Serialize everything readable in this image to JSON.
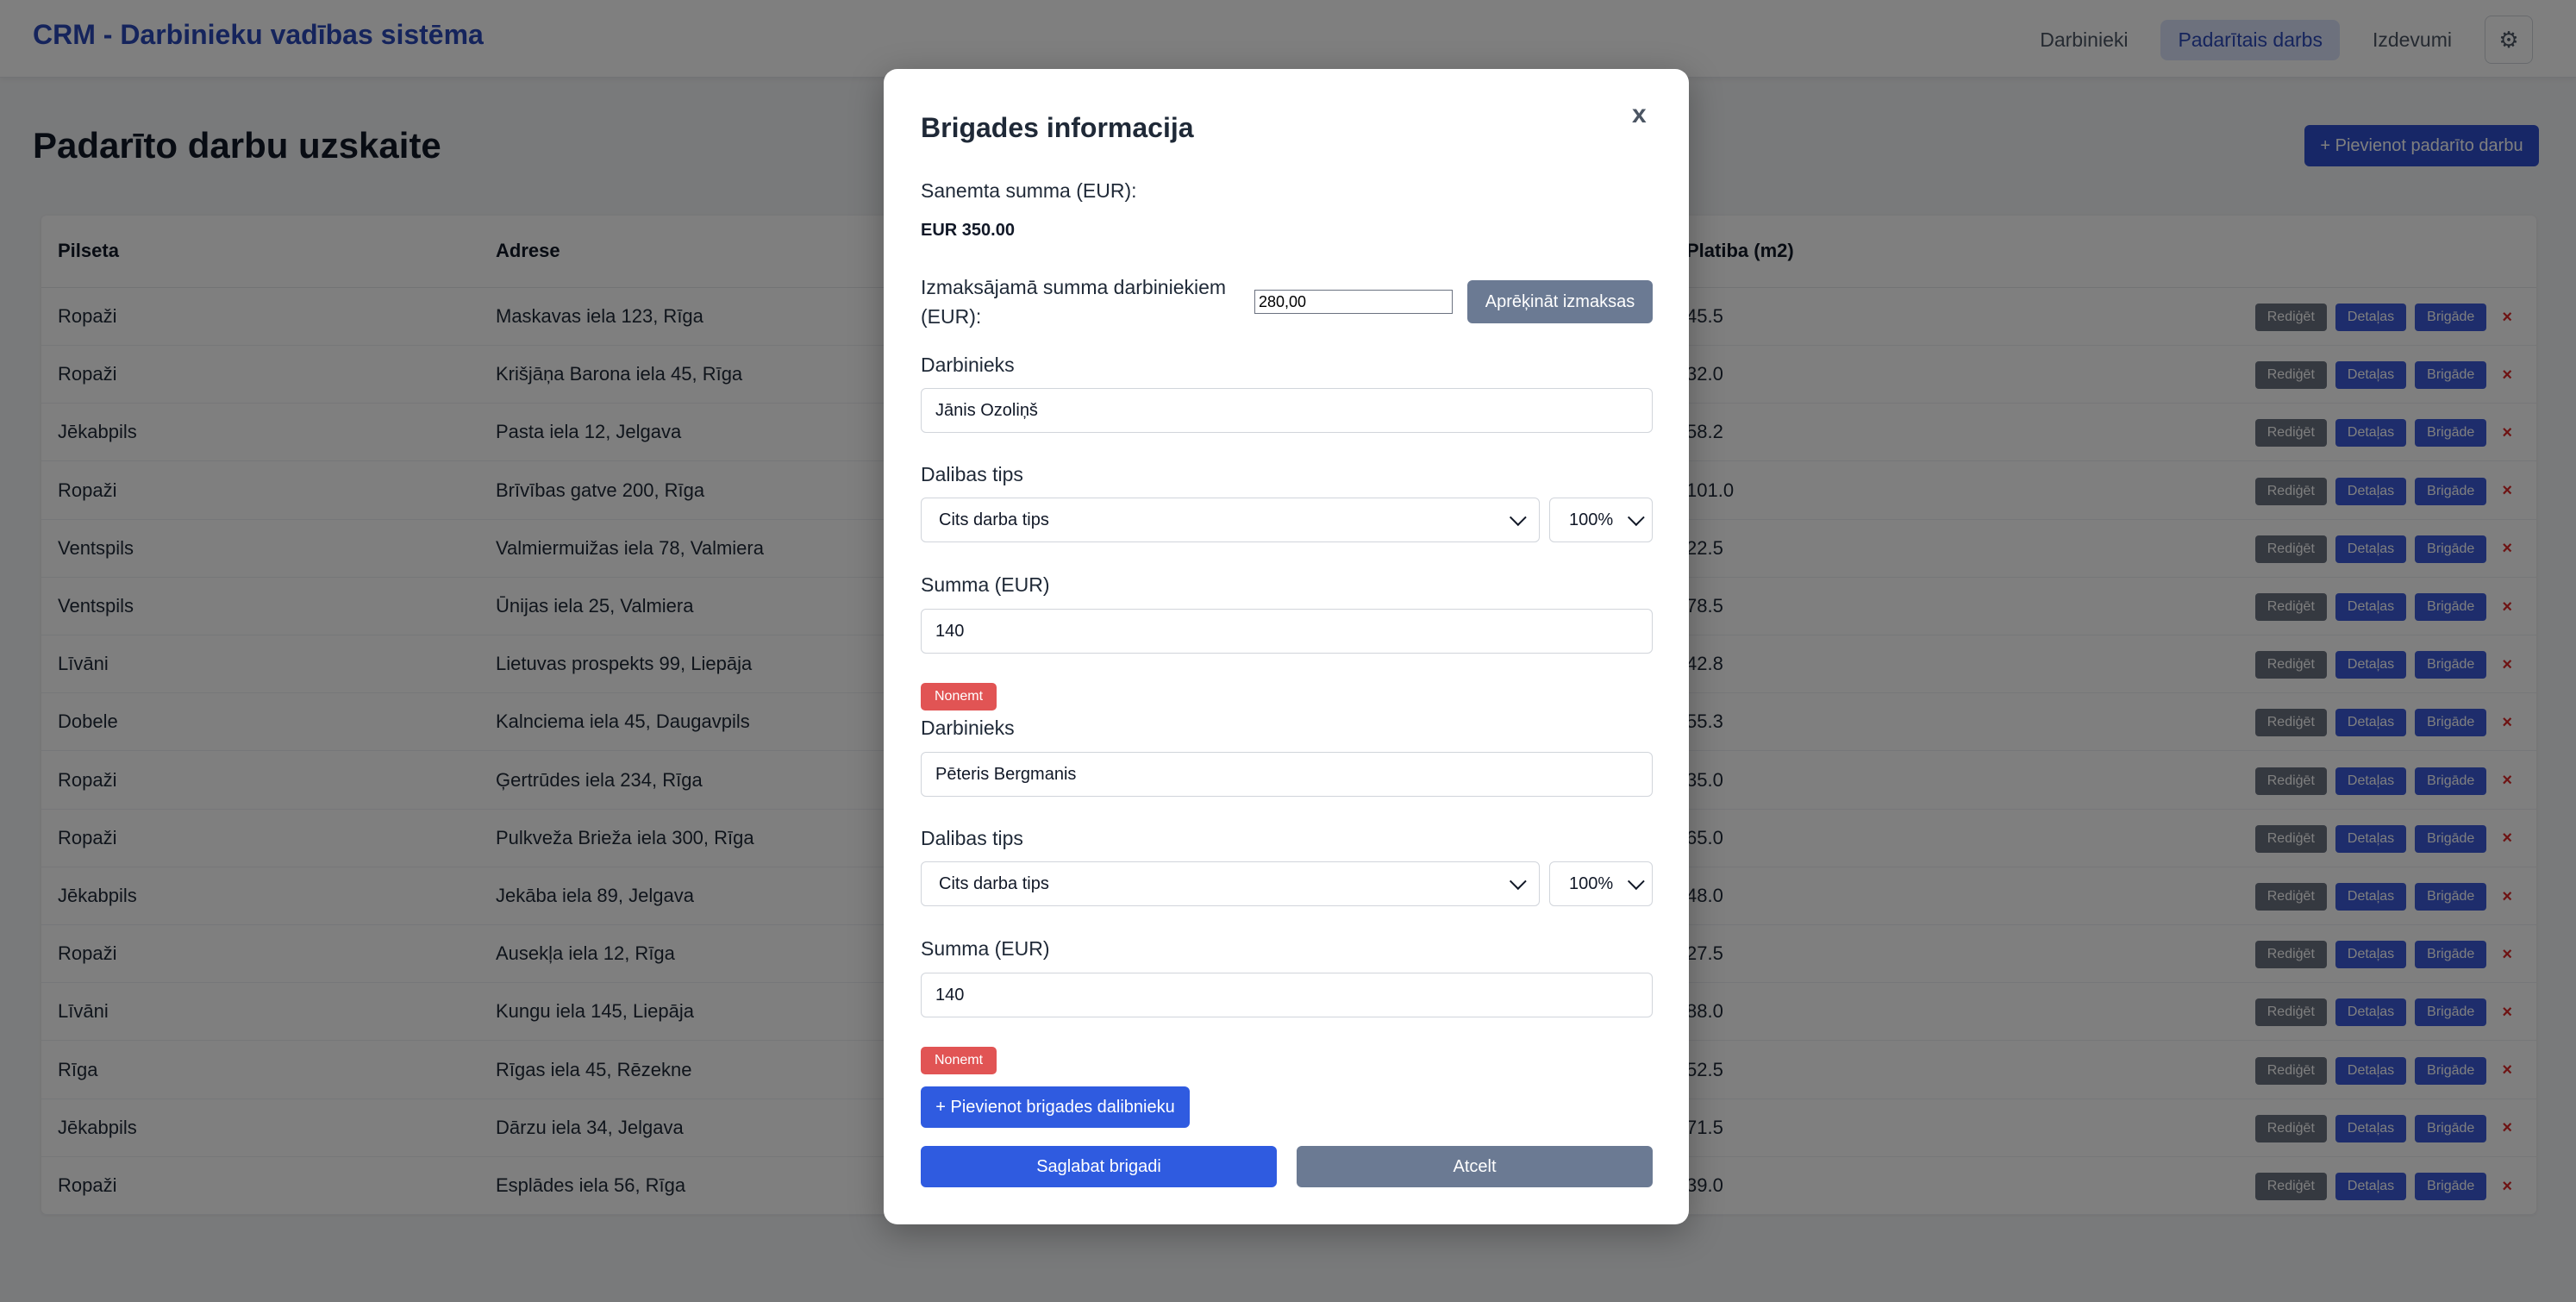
{
  "app": {
    "title": "CRM - Darbinieku vadības sistēma",
    "nav": [
      {
        "label": "Darbinieki",
        "active": false
      },
      {
        "label": "Padarītais darbs",
        "active": true
      },
      {
        "label": "Izdevumi",
        "active": false
      }
    ],
    "settings_icon": "gear-icon"
  },
  "page": {
    "title": "Padarīto darbu uzskaite",
    "add_button": "+ Pievienot padarīto darbu"
  },
  "table": {
    "headers": {
      "city": "Pilseta",
      "address": "Adrese",
      "area": "Platiba (m2)"
    },
    "action_labels": {
      "edit": "Rediģēt",
      "details": "Detaļas",
      "brigade": "Brigāde",
      "delete": "×"
    },
    "rows": [
      {
        "city": "Ropaži",
        "address": "Maskavas iela 123, Rīga",
        "area": "45.5"
      },
      {
        "city": "Ropaži",
        "address": "Krišjāņa Barona iela 45, Rīga",
        "area": "32.0"
      },
      {
        "city": "Jēkabpils",
        "address": "Pasta iela 12, Jelgava",
        "area": "58.2"
      },
      {
        "city": "Ropaži",
        "address": "Brīvības gatve 200, Rīga",
        "area": "101.0"
      },
      {
        "city": "Ventspils",
        "address": "Valmiermuižas iela 78, Valmiera",
        "area": "22.5"
      },
      {
        "city": "Ventspils",
        "address": "Ūnijas iela 25, Valmiera",
        "area": "78.5"
      },
      {
        "city": "Līvāni",
        "address": "Lietuvas prospekts 99, Liepāja",
        "area": "42.8"
      },
      {
        "city": "Dobele",
        "address": "Kalnciema iela 45, Daugavpils",
        "area": "55.3"
      },
      {
        "city": "Ropaži",
        "address": "Ģertrūdes iela 234, Rīga",
        "area": "35.0"
      },
      {
        "city": "Ropaži",
        "address": "Pulkveža Brieža iela 300, Rīga",
        "area": "65.0"
      },
      {
        "city": "Jēkabpils",
        "address": "Jekāba iela 89, Jelgava",
        "area": "48.0"
      },
      {
        "city": "Ropaži",
        "address": "Ausekļa iela 12, Rīga",
        "area": "27.5"
      },
      {
        "city": "Līvāni",
        "address": "Kungu iela 145, Liepāja",
        "area": "88.0"
      },
      {
        "city": "Rīga",
        "address": "Rīgas iela 45, Rēzekne",
        "area": "52.5"
      },
      {
        "city": "Jēkabpils",
        "address": "Dārzu iela 34, Jelgava",
        "area": "71.5"
      },
      {
        "city": "Ropaži",
        "address": "Esplādes iela 56, Rīga",
        "area": "39.0"
      }
    ]
  },
  "modal": {
    "title": "Brigades informacija",
    "close": "x",
    "received_label": "Sanemta summa (EUR):",
    "received_value": "EUR 350.00",
    "payout_label": "Izmaksājamā summa darbiniekiem (EUR):",
    "payout_value": "280,00",
    "calc_button": "Aprēķināt izmaksas",
    "worker_label": "Darbinieks",
    "activity_label": "Dalibas tips",
    "sum_label": "Summa (EUR)",
    "remove_button": "Nonemt",
    "members": [
      {
        "worker": "Jānis Ozoliņš",
        "activity": "Cits darba tips",
        "percent": "100%",
        "sum": "140"
      },
      {
        "worker": "Pēteris Bergmanis",
        "activity": "Cits darba tips",
        "percent": "100%",
        "sum": "140"
      }
    ],
    "add_member_button": "+ Pievienot brigades dalibnieku",
    "save_button": "Saglabat brigadi",
    "cancel_button": "Atcelt"
  }
}
